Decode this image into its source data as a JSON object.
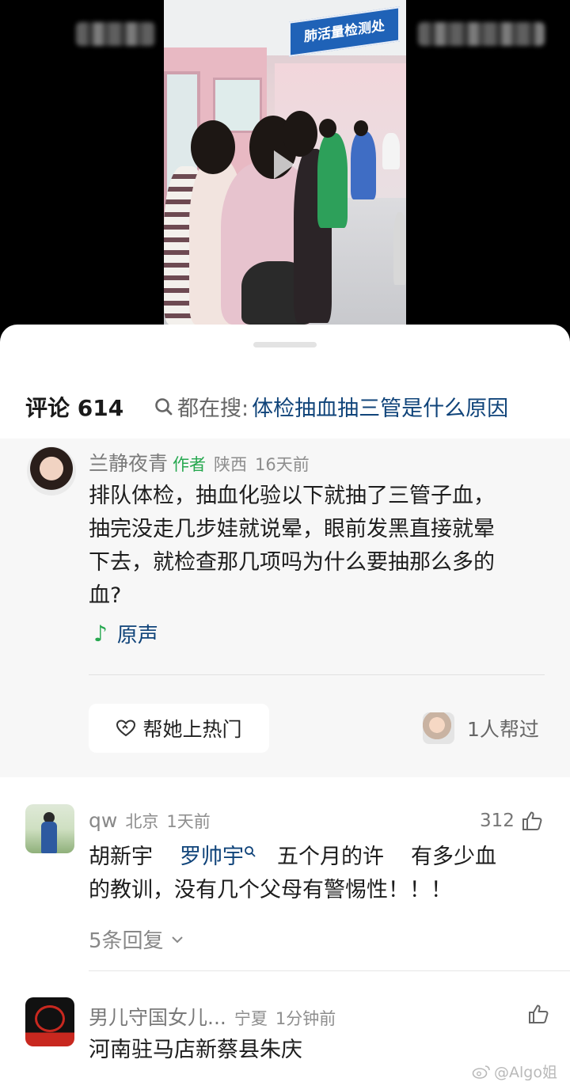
{
  "video": {
    "sign_text": "肺活量检测处"
  },
  "comments_header": {
    "count_label": "评论 614",
    "search_prefix": "都在搜:",
    "search_query": "体检抽血抽三管是什么原因"
  },
  "author_comment": {
    "name": "兰静夜青",
    "author_tag": "作者",
    "location": "陕西",
    "time": "16天前",
    "text_lines": [
      "排队体检，抽血化验以下就抽了三管子血，",
      "抽完没走几步娃就说晕，眼前发黑直接就晕",
      "下去，就检查那几项吗为什么要抽那么多的",
      "血?"
    ],
    "sound_label": "原声",
    "boost_label": "帮她上热门",
    "helped_label": "1人帮过"
  },
  "comments": [
    {
      "name": "qw",
      "location": "北京",
      "time": "1天前",
      "likes": "312",
      "segment_a": "胡新宇",
      "mention": "罗帅宇",
      "segment_b": "五个月的许",
      "segment_c": "有多少血",
      "line2": "的教训，没有几个父母有警惕性！！！",
      "replies_label": "5条回复"
    },
    {
      "name": "男儿守国女儿...",
      "location": "宁夏",
      "time": "1分钟前",
      "text": "河南驻马店新蔡县朱庆"
    }
  ],
  "watermark": "@Algo姐",
  "colors": {
    "link": "#10447a",
    "author_tag": "#27a850",
    "note": "#27a850",
    "author_block_bg": "#f7f7f7",
    "sign_bg": "#1f62b7"
  },
  "icons": [
    "play-icon",
    "search-icon",
    "music-note-icon",
    "heart-boost-icon",
    "thumbs-up-icon",
    "chevron-down-icon",
    "search-small-icon",
    "weibo-icon"
  ]
}
